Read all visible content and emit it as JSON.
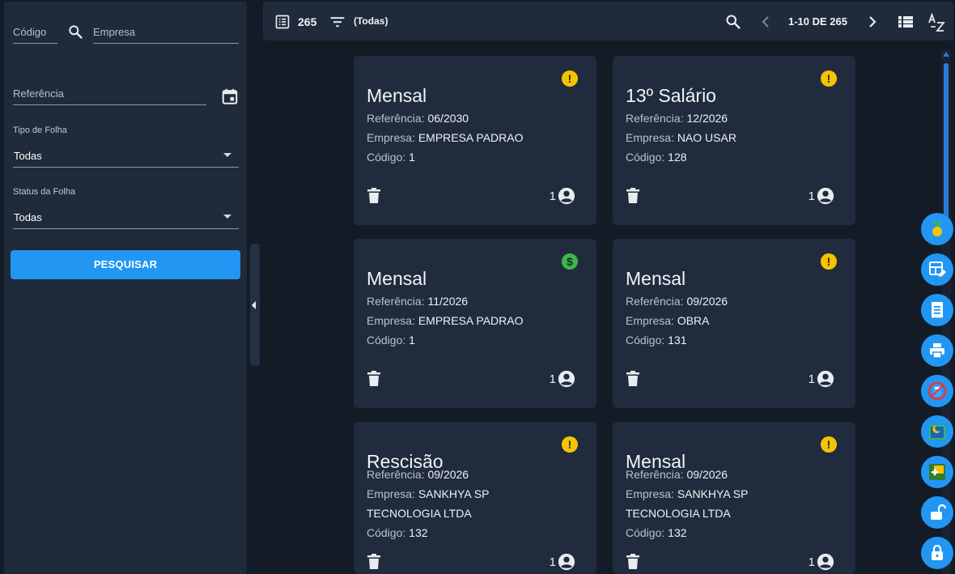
{
  "filters": {
    "codigo_placeholder": "Código",
    "empresa_placeholder": "Empresa",
    "referencia_placeholder": "Referência",
    "tipo_label": "Tipo de Folha",
    "tipo_value": "Todas",
    "status_label": "Status da Folha",
    "status_value": "Todas",
    "search_button": "PESQUISAR"
  },
  "toolbar": {
    "total": "265",
    "filter_text": "(Todas)",
    "pagination": "1-10 DE 265"
  },
  "icons": {
    "list": "list-alt-icon",
    "filter": "filter-icon",
    "search": "search-icon",
    "prev": "chevron-left-icon",
    "next": "chevron-right-icon",
    "view": "view-list-icon",
    "sort": "sort-alpha-icon",
    "calendar": "calendar-icon",
    "delete": "trash-icon",
    "person": "account-circle-icon",
    "warning": "exclamation-badge-icon",
    "money": "dollar-badge-icon"
  },
  "colors": {
    "accent": "#2196f3",
    "warning": "#f5c400",
    "money": "#3fb54a",
    "panel": "#1f2a3a",
    "background": "#131b26"
  },
  "cards": [
    {
      "title": "Mensal",
      "ref_label": "Referência:",
      "ref": "06/2030",
      "emp_label": "Empresa:",
      "empresa": "EMPRESA PADRAO",
      "cod_label": "Código:",
      "codigo": "1",
      "count": "1",
      "status": "warning"
    },
    {
      "title": "13º Salário",
      "ref_label": "Referência:",
      "ref": "12/2026",
      "emp_label": "Empresa:",
      "empresa": "NAO USAR",
      "cod_label": "Código:",
      "codigo": "128",
      "count": "1",
      "status": "warning"
    },
    {
      "title": "Mensal",
      "ref_label": "Referência:",
      "ref": "11/2026",
      "emp_label": "Empresa:",
      "empresa": "EMPRESA PADRAO",
      "cod_label": "Código:",
      "codigo": "1",
      "count": "1",
      "status": "money"
    },
    {
      "title": "Mensal",
      "ref_label": "Referência:",
      "ref": "09/2026",
      "emp_label": "Empresa:",
      "empresa": "OBRA",
      "cod_label": "Código:",
      "codigo": "131",
      "count": "1",
      "status": "warning"
    },
    {
      "title": "Rescisão",
      "ref_label": "Referência:",
      "ref": "09/2026",
      "emp_label": "Empresa:",
      "empresa": "SANKHYA SP",
      "empresa2": "TECNOLOGIA LTDA",
      "cod_label": "Código:",
      "codigo": "132",
      "count": "1",
      "status": "warning"
    },
    {
      "title": "Mensal",
      "ref_label": "Referência:",
      "ref": "09/2026",
      "emp_label": "Empresa:",
      "empresa": "SANKHYA SP",
      "empresa2": "TECNOLOGIA LTDA",
      "cod_label": "Código:",
      "codigo": "132",
      "count": "1",
      "status": "warning"
    }
  ],
  "fabs": [
    "medal-icon",
    "table-edit-icon",
    "receipt-icon",
    "printer-icon",
    "calculator-icon",
    "calendar-moon-icon",
    "add-box-icon",
    "lock-open-icon",
    "lock-icon"
  ]
}
